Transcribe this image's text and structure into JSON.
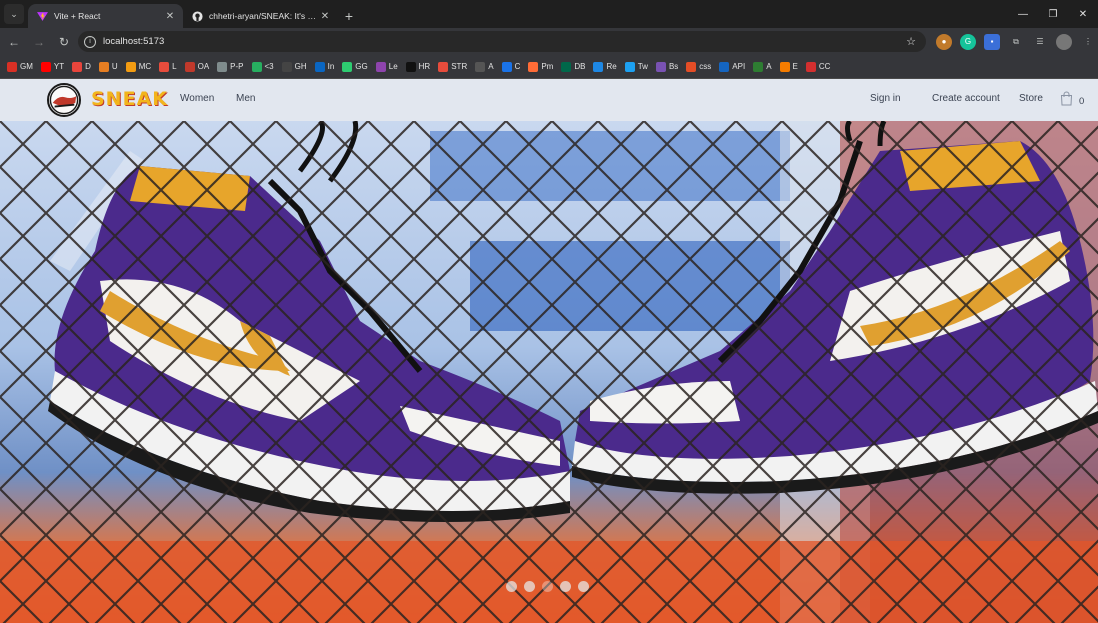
{
  "browser": {
    "tabs": [
      {
        "title": "Vite + React",
        "active": true,
        "favicon": "vite-icon"
      },
      {
        "title": "chhetri-aryan/SNEAK: It's an E-",
        "active": false,
        "favicon": "github-icon"
      }
    ],
    "url": "localhost:5173",
    "bookmarks": [
      {
        "label": "GM",
        "color": "#d93025"
      },
      {
        "label": "YT",
        "color": "#ff0000"
      },
      {
        "label": "D",
        "color": "#e8453c"
      },
      {
        "label": "U",
        "color": "#e67e22"
      },
      {
        "label": "MC",
        "color": "#f39c12"
      },
      {
        "label": "L",
        "color": "#e74c3c"
      },
      {
        "label": "OA",
        "color": "#c0392b"
      },
      {
        "label": "P-P",
        "color": "#7f8c8d"
      },
      {
        "label": "<3",
        "color": "#27ae60"
      },
      {
        "label": "GH",
        "color": "#444444"
      },
      {
        "label": "In",
        "color": "#0a66c2"
      },
      {
        "label": "GG",
        "color": "#2ecc71"
      },
      {
        "label": "Le",
        "color": "#8e44ad"
      },
      {
        "label": "HR",
        "color": "#111111"
      },
      {
        "label": "STR",
        "color": "#e74c3c"
      },
      {
        "label": "A",
        "color": "#555555"
      },
      {
        "label": "C",
        "color": "#1a73e8"
      },
      {
        "label": "Pm",
        "color": "#ff6c37"
      },
      {
        "label": "DB",
        "color": "#00684a"
      },
      {
        "label": "Re",
        "color": "#1e88e5"
      },
      {
        "label": "Tw",
        "color": "#1da1f2"
      },
      {
        "label": "Bs",
        "color": "#7952b3"
      },
      {
        "label": "css",
        "color": "#e44d26"
      },
      {
        "label": "API",
        "color": "#1565c0"
      },
      {
        "label": "A",
        "color": "#2e7d32"
      },
      {
        "label": "E",
        "color": "#f57c00"
      },
      {
        "label": "CC",
        "color": "#d32f2f"
      }
    ]
  },
  "site": {
    "brand": "SNEAK",
    "logo_text": "SNEAK",
    "nav": {
      "women": "Women",
      "men": "Men"
    },
    "right": {
      "sign_in": "Sign in",
      "create_account": "Create account",
      "store": "Store",
      "cart_count": "0"
    },
    "carousel": {
      "slides": 5,
      "active_index": 2
    }
  }
}
